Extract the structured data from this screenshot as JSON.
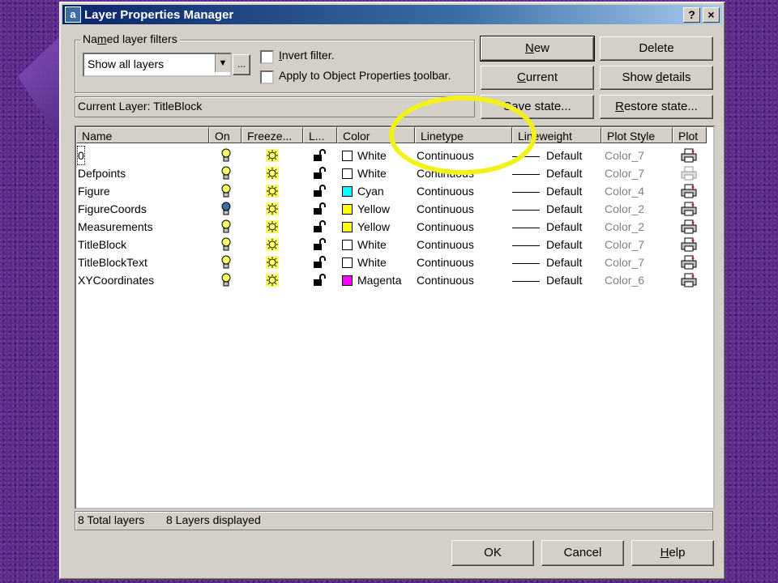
{
  "window": {
    "title": "Layer Properties Manager",
    "help_btn": "?",
    "close_btn": "×"
  },
  "filters": {
    "group_label": "Named layer filters",
    "selected": "Show all layers",
    "browse_btn": "...",
    "invert_label": "Invert filter.",
    "apply_label": "Apply to Object Properties toolbar."
  },
  "buttons": {
    "new": "New",
    "delete": "Delete",
    "current": "Current",
    "show_details": "Show details",
    "save_state": "Save state...",
    "restore_state": "Restore state...",
    "ok": "OK",
    "cancel": "Cancel",
    "help": "Help"
  },
  "current_layer": "Current Layer:  TitleBlock",
  "columns": [
    "Name",
    "On",
    "Freeze...",
    "L...",
    "Color",
    "Linetype",
    "Lineweight",
    "Plot Style",
    "Plot"
  ],
  "rows": [
    {
      "name": "0",
      "color_name": "White",
      "color": "#ffffff",
      "linetype": "Continuous",
      "lineweight": "Default",
      "plot_style": "Color_7",
      "on": true,
      "plot": true
    },
    {
      "name": "Defpoints",
      "color_name": "White",
      "color": "#ffffff",
      "linetype": "Continuous",
      "lineweight": "Default",
      "plot_style": "Color_7",
      "on": true,
      "plot": false
    },
    {
      "name": "Figure",
      "color_name": "Cyan",
      "color": "#00ffff",
      "linetype": "Continuous",
      "lineweight": "Default",
      "plot_style": "Color_4",
      "on": true,
      "plot": true
    },
    {
      "name": "FigureCoords",
      "color_name": "Yellow",
      "color": "#ffff00",
      "linetype": "Continuous",
      "lineweight": "Default",
      "plot_style": "Color_2",
      "on": false,
      "plot": true
    },
    {
      "name": "Measurements",
      "color_name": "Yellow",
      "color": "#ffff00",
      "linetype": "Continuous",
      "lineweight": "Default",
      "plot_style": "Color_2",
      "on": true,
      "plot": true
    },
    {
      "name": "TitleBlock",
      "color_name": "White",
      "color": "#ffffff",
      "linetype": "Continuous",
      "lineweight": "Default",
      "plot_style": "Color_7",
      "on": true,
      "plot": true
    },
    {
      "name": "TitleBlockText",
      "color_name": "White",
      "color": "#ffffff",
      "linetype": "Continuous",
      "lineweight": "Default",
      "plot_style": "Color_7",
      "on": true,
      "plot": true
    },
    {
      "name": "XYCoordinates",
      "color_name": "Magenta",
      "color": "#ff00ff",
      "linetype": "Continuous",
      "lineweight": "Default",
      "plot_style": "Color_6",
      "on": true,
      "plot": true
    }
  ],
  "status": {
    "total": "8 Total layers",
    "displayed": "8 Layers displayed"
  }
}
